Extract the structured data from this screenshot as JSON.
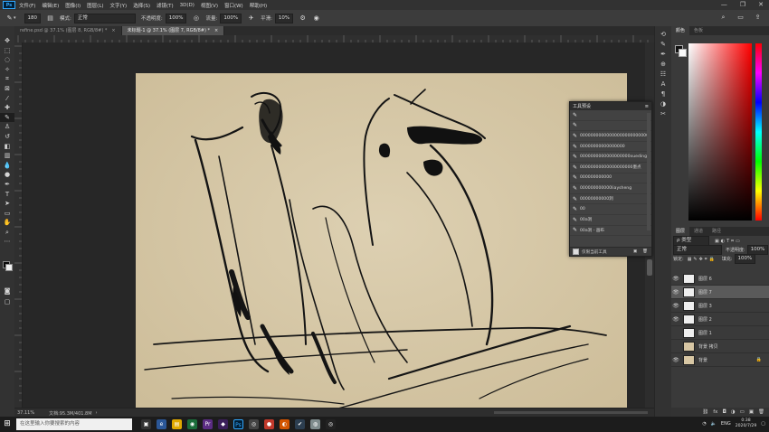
{
  "menubar": {
    "logo": "Ps",
    "items": [
      "文件(F)",
      "编辑(E)",
      "图像(I)",
      "图层(L)",
      "文字(Y)",
      "选择(S)",
      "滤镜(T)",
      "3D(D)",
      "视图(V)",
      "窗口(W)",
      "帮助(H)"
    ],
    "window_controls": [
      "—",
      "❐",
      "✕"
    ]
  },
  "options": {
    "brush_size": "180",
    "mode_label": "模式:",
    "mode_value": "正常",
    "opacity_label": "不透明度:",
    "opacity_value": "100%",
    "flow_label": "流量:",
    "flow_value": "100%",
    "smooth_label": "平滑:",
    "smooth_value": "10%"
  },
  "tabs": [
    {
      "label": "refine.psd @ 37.1% (图层 8, RGB/8#) *",
      "close": "×"
    },
    {
      "label": "未标题-1 @ 37.1% (图层 7, RGB/8#) *",
      "close": "×"
    }
  ],
  "status": {
    "zoom": "37.11%",
    "doc": "文档:95.3M/401.8M"
  },
  "panels": {
    "color_tabs": [
      "颜色",
      "色板"
    ],
    "layers_tabs": [
      "图层",
      "通道",
      "路径"
    ],
    "filter_label": "ρ 类型",
    "blend_mode": "正常",
    "opacity_label": "不透明度:",
    "opacity_value": "100%",
    "lock_label": "锁定:",
    "fill_label": "填充:",
    "fill_value": "100%",
    "layers": [
      {
        "name": "图层 6",
        "visible": true,
        "selected": false,
        "thumb": "white"
      },
      {
        "name": "图层 7",
        "visible": true,
        "selected": true,
        "thumb": "white"
      },
      {
        "name": "图层 3",
        "visible": true,
        "selected": false,
        "thumb": "white"
      },
      {
        "name": "图层 2",
        "visible": true,
        "selected": false,
        "thumb": "white"
      },
      {
        "name": "图层 1",
        "visible": false,
        "selected": false,
        "thumb": "white"
      },
      {
        "name": "背景 拷贝",
        "visible": false,
        "selected": false,
        "thumb": "tan"
      },
      {
        "name": "背景",
        "visible": true,
        "selected": false,
        "thumb": "tan"
      }
    ]
  },
  "presets": {
    "title": "工具预设",
    "items": [
      "",
      "",
      "00000000000000000000000000",
      "00000000000000000",
      "0000000000000000000xueding",
      "00000000000000000000墨点",
      "000000000000",
      "000000000000liaysheng",
      "00000000000洞",
      "00",
      "00a洞",
      "00a洞 - 画布"
    ],
    "footer": "仅限当前工具"
  },
  "taskbar": {
    "search_placeholder": "在这里输入你要搜索的内容",
    "lang": "ENG",
    "time": "0:38",
    "date": "2020/7/29"
  },
  "colors": {
    "accent": "#31a8ff",
    "parchment": "#d9c9a8"
  }
}
